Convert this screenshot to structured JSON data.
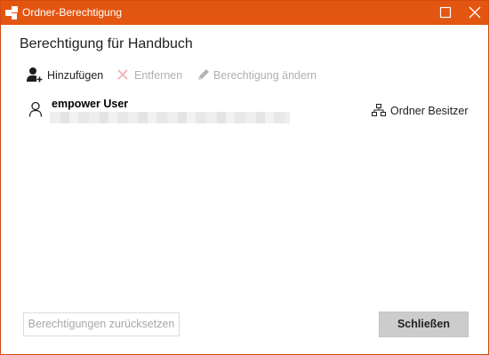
{
  "window": {
    "title": "Ordner-Berechtigung",
    "titlebar_color": "#e35612",
    "icons": [
      "app-icon",
      "maximize-icon",
      "close-icon"
    ]
  },
  "dialog": {
    "heading": "Berechtigung für Handbuch"
  },
  "toolbar": {
    "add_label": "Hinzufügen",
    "add_icon": "add-user-icon",
    "remove_label": "Entfernen",
    "remove_icon": "x-icon",
    "change_label": "Berechtigung ändern",
    "change_icon": "pencil-icon",
    "disabled_color": "#b0b0b0"
  },
  "permissions": [
    {
      "name": "empower User",
      "icon": "user-icon",
      "role_icon": "hierarchy-icon",
      "role": "Ordner Besitzer"
    }
  ],
  "footer": {
    "reset_label": "Berechtigungen zurücksetzen",
    "close_label": "Schließen"
  }
}
